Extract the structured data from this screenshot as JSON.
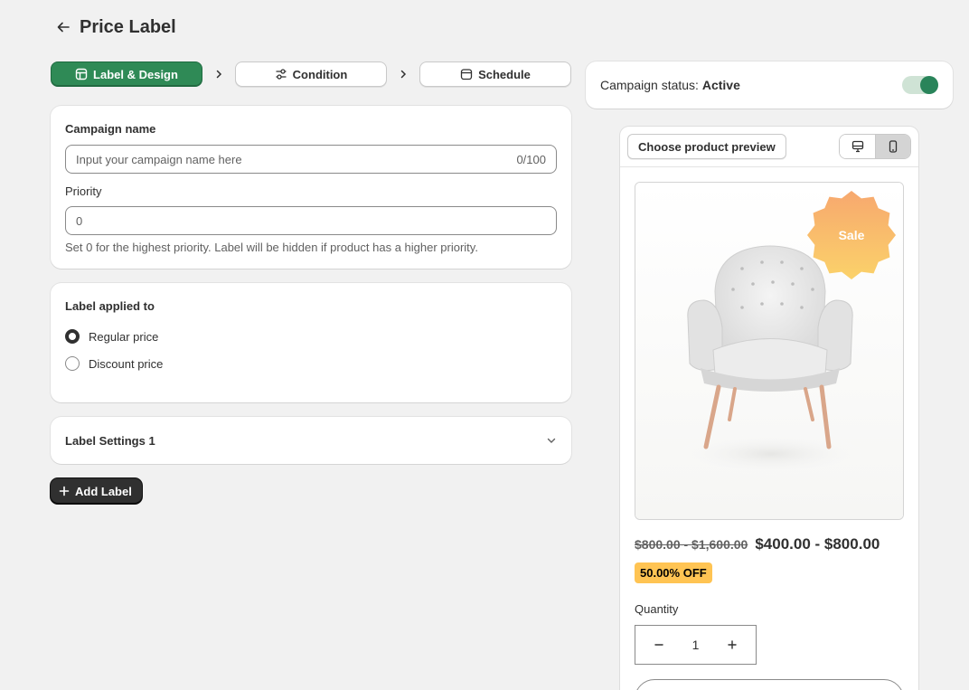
{
  "header": {
    "title": "Price Label",
    "back_icon": "arrow-left-icon"
  },
  "steps": [
    {
      "label": "Label & Design",
      "icon": "layout-icon",
      "active": true
    },
    {
      "label": "Condition",
      "icon": "sliders-icon",
      "active": false
    },
    {
      "label": "Schedule",
      "icon": "calendar-icon",
      "active": false
    }
  ],
  "campaign": {
    "name_label": "Campaign name",
    "name_placeholder": "Input your campaign name here",
    "name_counter": "0/100",
    "priority_label": "Priority",
    "priority_value": "0",
    "priority_help": "Set 0 for the highest priority. Label will be hidden if product has a higher priority."
  },
  "applied": {
    "title": "Label applied to",
    "options": [
      {
        "label": "Regular price",
        "checked": true
      },
      {
        "label": "Discount price",
        "checked": false
      }
    ]
  },
  "settings": {
    "title": "Label Settings 1"
  },
  "add_label": "Add Label",
  "status": {
    "prefix": "Campaign status:",
    "value": "Active",
    "enabled": true
  },
  "preview": {
    "choose_label": "Choose product preview",
    "sale_badge": "Sale",
    "old_price": "$800.00 - $1,600.00",
    "new_price": "$400.00 - $800.00",
    "discount": "50.00% OFF",
    "quantity_label": "Quantity",
    "quantity": "1"
  },
  "colors": {
    "primary": "#2f8a56",
    "badge": "#ffc453",
    "sale_top": "#f7a86e",
    "sale_bottom": "#fbd26a"
  }
}
